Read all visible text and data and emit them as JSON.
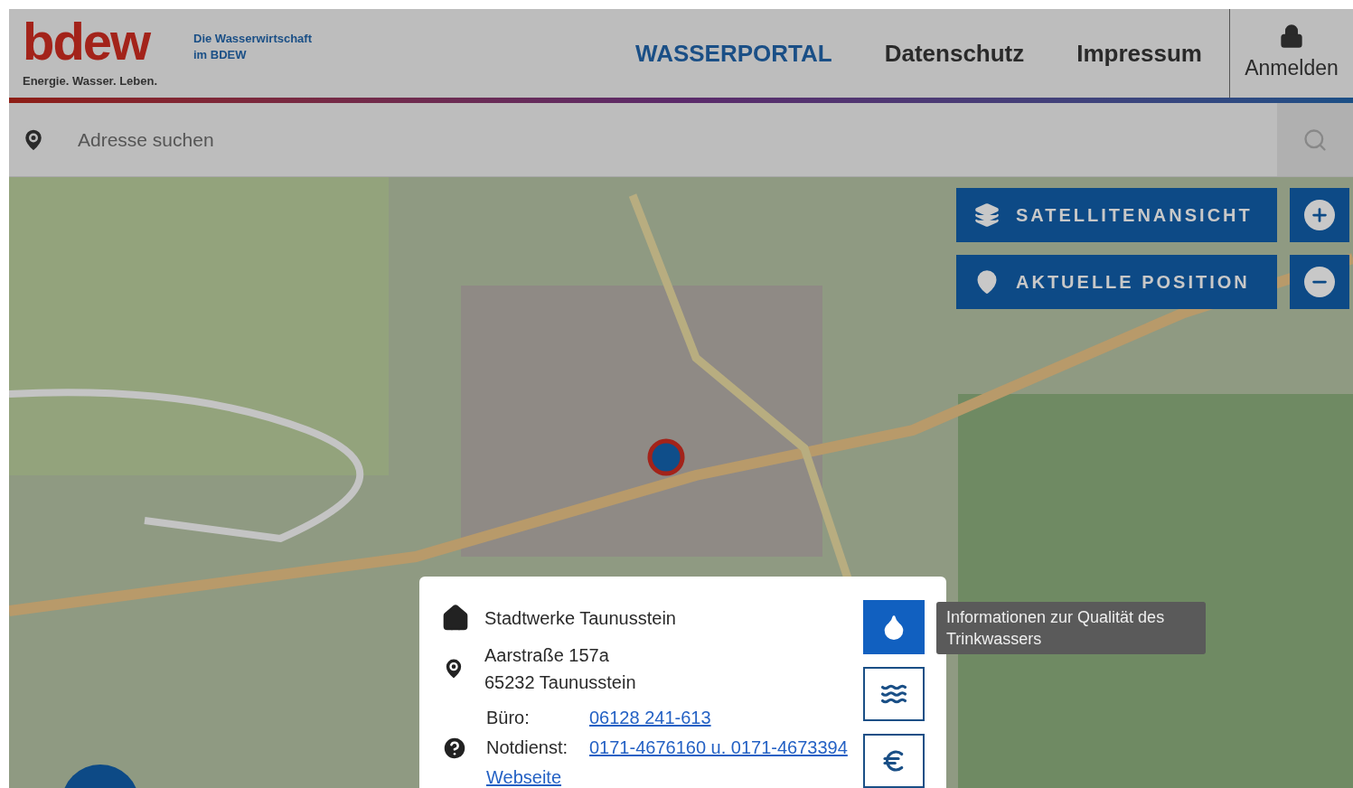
{
  "header": {
    "logo": {
      "wordmark": "bdew",
      "tagline": "Energie. Wasser. Leben."
    },
    "subtitle": [
      "Die Wasserwirtschaft",
      "im BDEW"
    ],
    "nav": [
      {
        "label": "WASSERPORTAL",
        "selected": true
      },
      {
        "label": "Datenschutz",
        "selected": false
      },
      {
        "label": "Impressum",
        "selected": false
      }
    ],
    "login": "Anmelden"
  },
  "search": {
    "placeholder": "Adresse suchen"
  },
  "map_controls": [
    {
      "kind": "layers",
      "label": "SATELLITENANSICHT"
    },
    {
      "kind": "position",
      "label": "AKTUELLE POSITION"
    }
  ],
  "popup": {
    "name": "Stadtwerke Taunusstein",
    "address": [
      "Aarstraße 157a",
      "65232 Taunusstein"
    ],
    "contacts": [
      {
        "label": "Büro:",
        "value": "06128 241-613"
      },
      {
        "label": "Notdienst:",
        "value": "0171-4676160 u. 0171-4673394"
      }
    ],
    "link": "Webseite",
    "actions": [
      {
        "kind": "quality",
        "selected": true
      },
      {
        "kind": "waves",
        "selected": false
      },
      {
        "kind": "price",
        "selected": false
      }
    ],
    "tooltip": "Informationen zur Qualität des Trinkwassers"
  }
}
